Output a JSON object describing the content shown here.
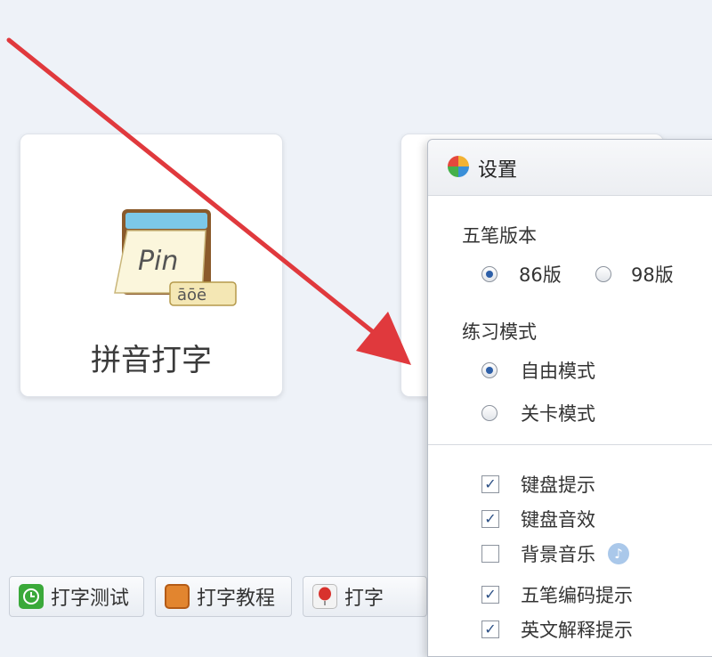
{
  "cards": [
    {
      "label": "拼音打字",
      "icon": "pin-calendar-icon",
      "icon_text": "Pin",
      "icon_sub": "āōē"
    }
  ],
  "toolbar": {
    "buttons": [
      {
        "label": "打字测试",
        "icon": "clock-icon"
      },
      {
        "label": "打字教程",
        "icon": "book-icon"
      },
      {
        "label": "打字",
        "icon": "balloon-icon"
      }
    ]
  },
  "settings_dialog": {
    "title": "设置",
    "wubi_version": {
      "title": "五笔版本",
      "options": [
        {
          "label": "86版",
          "selected": true
        },
        {
          "label": "98版",
          "selected": false
        }
      ]
    },
    "practice_mode": {
      "title": "练习模式",
      "options": [
        {
          "label": "自由模式",
          "selected": true
        },
        {
          "label": "关卡模式",
          "selected": false
        }
      ]
    },
    "checkboxes": [
      {
        "label": "键盘提示",
        "checked": true
      },
      {
        "label": "键盘音效",
        "checked": true
      },
      {
        "label": "背景音乐",
        "checked": false,
        "icon": "music-note-icon"
      },
      {
        "label": "五笔编码提示",
        "checked": true
      },
      {
        "label": "英文解释提示",
        "checked": true
      }
    ]
  },
  "colors": {
    "background": "#eef2f8",
    "arrow": "#e0393d",
    "radio_selected": "#2d5fa8"
  }
}
